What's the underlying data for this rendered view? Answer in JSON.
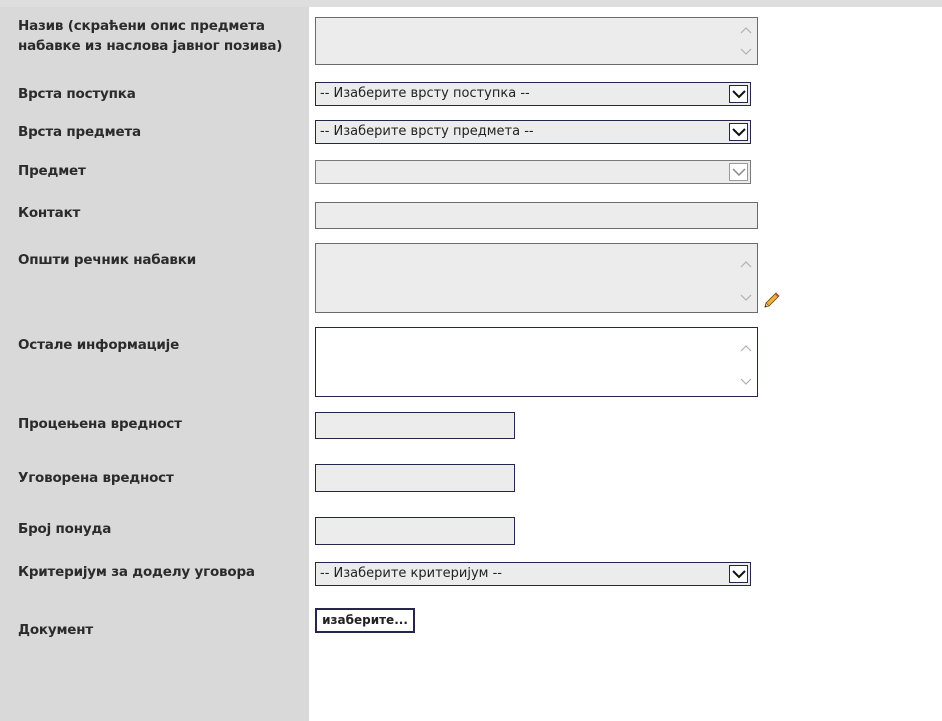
{
  "form": {
    "naziv": {
      "label": "Назив (скраћени опис предмета набавке из наслова јавног позива)"
    },
    "vrsta_postupka": {
      "label": "Врста поступка",
      "selected": "-- Изаберите врсту поступка --"
    },
    "vrsta_predmeta": {
      "label": "Врста предмета",
      "selected": "-- Изаберите врсту предмета --"
    },
    "predmet": {
      "label": "Предмет",
      "selected": ""
    },
    "kontakt": {
      "label": "Контакт",
      "value": ""
    },
    "opsti_recnik": {
      "label": "Општи речник набавки"
    },
    "ostale_info": {
      "label": "Остале информације"
    },
    "procenjena": {
      "label": "Процењена вредност",
      "value": ""
    },
    "ugovorena": {
      "label": "Уговорена вредност",
      "value": ""
    },
    "broj_ponuda": {
      "label": "Број понуда",
      "value": ""
    },
    "kriterijum": {
      "label": "Критеријум за доделу уговора",
      "selected": "-- Изаберите критеријум --"
    },
    "dokument": {
      "label": "Документ",
      "button": "изаберите..."
    }
  },
  "icons": {
    "scroll_up": "chevron-up-icon",
    "scroll_down": "chevron-down-icon",
    "dropdown": "chevron-down-icon",
    "edit": "pencil-icon"
  },
  "colors": {
    "sidebar_bg": "#d9d9d9",
    "field_bg": "#ececec",
    "border_dark": "#26264a"
  }
}
